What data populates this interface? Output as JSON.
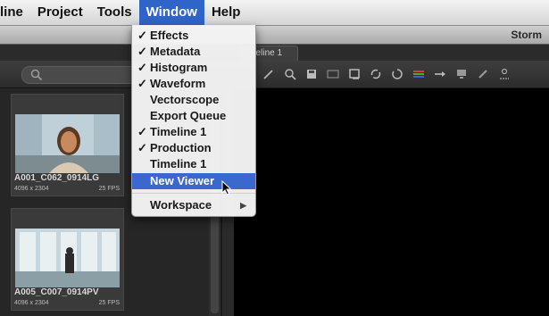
{
  "menubar": {
    "items": [
      "line",
      "Project",
      "Tools",
      "Window",
      "Help"
    ]
  },
  "titlebar": {
    "app_name": "Storm"
  },
  "viewer_tab": {
    "label": "neline 1"
  },
  "search": {
    "placeholder": ""
  },
  "toolbar_icons": [
    "pencil-icon",
    "zoom-icon",
    "save-icon",
    "monitor-icon",
    "crop-icon",
    "sync-icon",
    "rotate-icon",
    "color-bars-icon",
    "arrow-right-icon",
    "display-icon",
    "brush-icon",
    "people-icon"
  ],
  "window_menu": {
    "items": [
      {
        "label": "Effects",
        "checked": "✓"
      },
      {
        "label": "Metadata",
        "checked": "✓"
      },
      {
        "label": "Histogram",
        "checked": "✓"
      },
      {
        "label": "Waveform",
        "checked": "✓"
      },
      {
        "label": "Vectorscope",
        "checked": ""
      },
      {
        "label": "Export Queue",
        "checked": ""
      },
      {
        "label": "Timeline 1",
        "checked": "✓"
      },
      {
        "label": "Production",
        "checked": "✓"
      },
      {
        "label": "Timeline 1",
        "checked": ""
      }
    ],
    "new_viewer": "New Viewer",
    "workspace": "Workspace",
    "submenu_arrow": "▶"
  },
  "clips": [
    {
      "name": "A001_C062_0914LG",
      "resolution": "4096 x 2304",
      "fps": "25 FPS"
    },
    {
      "name": "A005_C007_0914PV",
      "resolution": "4096 x 2304",
      "fps": "25 FPS"
    }
  ],
  "colors": {
    "menu_highlight": "#3b68cf",
    "menubar_active": "#2f64c9",
    "viewer_bg": "#000000"
  }
}
